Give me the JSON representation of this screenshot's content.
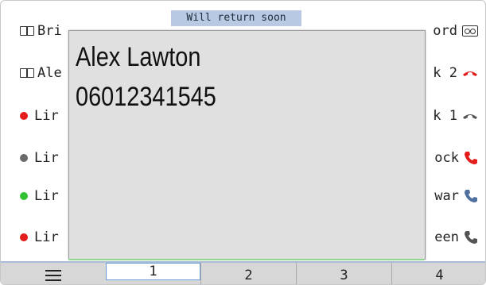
{
  "status_banner": "Will return soon",
  "left_items": [
    {
      "icon": "book-icon",
      "label": "Bri"
    },
    {
      "icon": "book-icon",
      "label": "Ale"
    },
    {
      "icon": "dot",
      "color": "#e31b1b",
      "label": "Lir"
    },
    {
      "icon": "dot",
      "color": "#6a6a6a",
      "label": "Lir"
    },
    {
      "icon": "dot",
      "color": "#32c132",
      "label": "Lir"
    },
    {
      "icon": "dot",
      "color": "#e31b1b",
      "label": "Lir"
    }
  ],
  "right_items": [
    {
      "label": "ord",
      "icon": "voicemail-icon",
      "color": "#333333"
    },
    {
      "label": "k 2",
      "icon": "hangup-icon",
      "color": "#e31b1b"
    },
    {
      "label": "k 1",
      "icon": "hangup-icon",
      "color": "#555555"
    },
    {
      "label": "ock",
      "icon": "phone-icon",
      "color": "#e31b1b"
    },
    {
      "label": "war",
      "icon": "phone-icon",
      "color": "#4f6f9f"
    },
    {
      "label": "een",
      "icon": "phone-icon",
      "color": "#555555"
    }
  ],
  "popup": {
    "name": "Alex Lawton",
    "number": "06012341545"
  },
  "tabs": [
    "1",
    "2",
    "3",
    "4"
  ],
  "active_tab": "1"
}
